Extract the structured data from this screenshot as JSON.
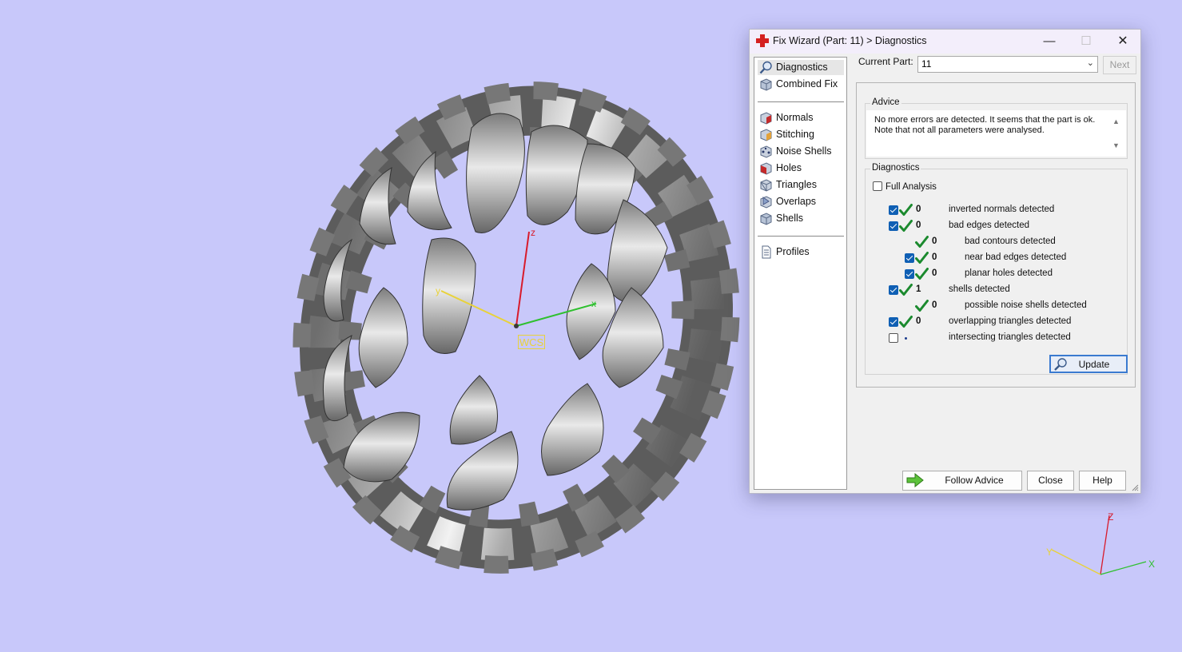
{
  "viewport": {
    "background": "#c8c8fa",
    "model": "chain-ring",
    "wcs_label": "WCS",
    "axis_labels": {
      "x": "x",
      "y": "y",
      "z": "z"
    },
    "triad_labels": {
      "x": "X",
      "y": "Y",
      "z": "Z"
    },
    "axis_colors": {
      "x": "#2fc02f",
      "y": "#e8d23a",
      "z": "#d81b2b"
    }
  },
  "dialog": {
    "title": "Fix Wizard (Part: 11) > Diagnostics",
    "window_buttons": {
      "minimize": "—",
      "maximize": "☐",
      "close": "✕"
    },
    "nav": {
      "group1": [
        {
          "label": "Diagnostics",
          "icon": "magnifier-icon",
          "selected": true
        },
        {
          "label": "Combined Fix",
          "icon": "cube-icon"
        }
      ],
      "group2": [
        {
          "label": "Normals",
          "icon": "normals-icon"
        },
        {
          "label": "Stitching",
          "icon": "stitching-icon"
        },
        {
          "label": "Noise Shells",
          "icon": "noise-shells-icon"
        },
        {
          "label": "Holes",
          "icon": "holes-icon"
        },
        {
          "label": "Triangles",
          "icon": "triangles-icon"
        },
        {
          "label": "Overlaps",
          "icon": "overlaps-icon"
        },
        {
          "label": "Shells",
          "icon": "shells-icon"
        }
      ],
      "group3": [
        {
          "label": "Profiles",
          "icon": "document-icon"
        }
      ]
    },
    "current_part": {
      "label": "Current Part:",
      "value": "11",
      "next_label": "Next"
    },
    "advice": {
      "title": "Advice",
      "lines": [
        "No more errors are detected. It seems that the part is ok.",
        "Note that not all parameters were analysed."
      ]
    },
    "diagnostics": {
      "title": "Diagnostics",
      "full_analysis": {
        "label": "Full Analysis",
        "checked": false
      },
      "rows": [
        {
          "checkbox": "on",
          "status": "ok",
          "count": "0",
          "label": "inverted normals detected",
          "indent": 0
        },
        {
          "checkbox": "on",
          "status": "ok",
          "count": "0",
          "label": "bad edges detected",
          "indent": 0
        },
        {
          "checkbox": "none",
          "status": "ok",
          "count": "0",
          "label": "bad contours detected",
          "indent": 1
        },
        {
          "checkbox": "on",
          "status": "ok",
          "count": "0",
          "label": "near bad edges detected",
          "indent": 1
        },
        {
          "checkbox": "on",
          "status": "ok",
          "count": "0",
          "label": "planar holes detected",
          "indent": 1
        },
        {
          "checkbox": "on",
          "status": "ok",
          "count": "1",
          "label": "shells detected",
          "indent": 0
        },
        {
          "checkbox": "none",
          "status": "ok",
          "count": "0",
          "label": "possible noise shells detected",
          "indent": 1
        },
        {
          "checkbox": "on",
          "status": "ok",
          "count": "0",
          "label": "overlapping triangles detected",
          "indent": 0
        },
        {
          "checkbox": "off",
          "status": "dot",
          "count": "",
          "label": "intersecting triangles detected",
          "indent": 0
        }
      ],
      "update_label": "Update"
    },
    "buttons": {
      "follow_advice": "Follow Advice",
      "close": "Close",
      "help": "Help"
    },
    "colors": {
      "accent": "#0f5fb4",
      "ok_green": "#1b8a2e",
      "title_bg": "#f3eefb"
    }
  }
}
